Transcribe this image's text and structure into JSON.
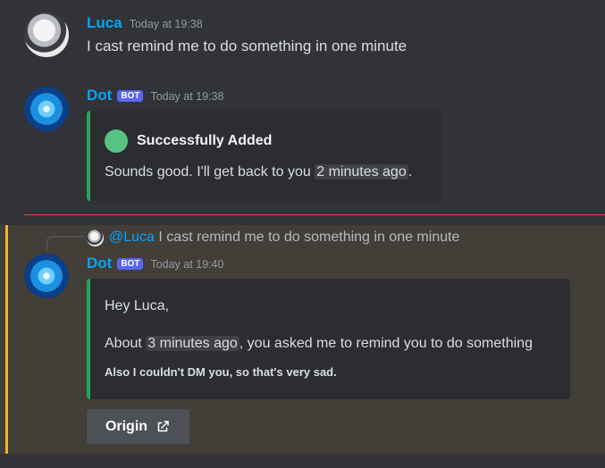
{
  "messages": [
    {
      "author": "Luca",
      "timestamp": "Today at 19:38",
      "text": "I cast remind me to do something in one minute",
      "avatar_icon": "user-avatar-icon"
    },
    {
      "author": "Dot",
      "tag": "BOT",
      "timestamp": "Today at 19:38",
      "embed": {
        "color": "#23a55a",
        "title": "Successfully Added",
        "text_before": "Sounds good. I'll get back to you ",
        "relative_time": "2 minutes ago",
        "text_after": "."
      },
      "avatar_icon": "bot-avatar-icon"
    },
    {
      "author": "Dot",
      "tag": "BOT",
      "timestamp": "Today at 19:40",
      "reply": {
        "mention": "@Luca",
        "text": "I cast remind me to do something in one minute"
      },
      "embed": {
        "color": "#23a55a",
        "greeting": "Hey Luca,",
        "about_before": "About ",
        "relative_time": "3 minutes ago",
        "about_after": ", you asked me to remind you to do something",
        "small_note": "Also I couldn't DM you, so that's very sad."
      },
      "button": {
        "label": "Origin",
        "icon": "external-link-icon"
      }
    }
  ],
  "colors": {
    "background": "#313338",
    "username": "#00a8fc",
    "bot_tag": "#5865f2",
    "embed_border": "#23a55a",
    "new_messages_line": "#f23f43",
    "mention_highlight_bar": "#f0b232"
  }
}
